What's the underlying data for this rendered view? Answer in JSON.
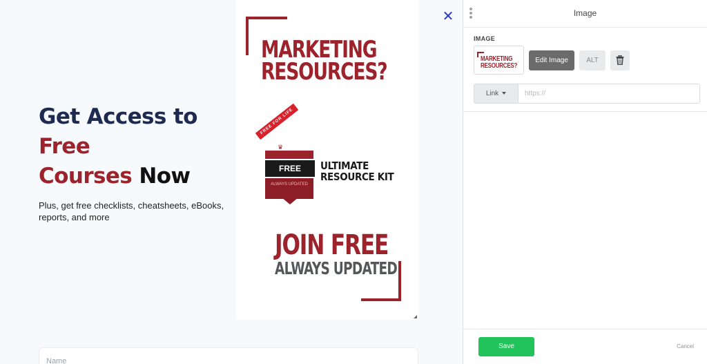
{
  "canvas": {
    "hero": {
      "line1": "Get Access to",
      "line2": "Free",
      "line3a": "Courses",
      "line3b": "Now",
      "subtitle": "Plus, get free checklists, cheatsheets, eBooks, reports, and more"
    },
    "promo": {
      "headline_1": "MARKETING",
      "headline_2": "RESOURCES?",
      "ribbon": "FREE FOR LIFE",
      "kit_badge": "FREE",
      "kit_badge_sub": "ALWAYS UPDATED",
      "kit_title_1": "ULTIMATE",
      "kit_title_2": "RESOURCE KIT",
      "join": "JOIN FREE",
      "always": "ALWAYS UPDATED"
    },
    "close_icon": "close-icon",
    "name_placeholder": "Name",
    "colors": {
      "navy": "#1e2a4f",
      "brand_red": "#9c232c",
      "close_blue": "#2a35c9"
    }
  },
  "panel": {
    "title": "Image",
    "section_label": "IMAGE",
    "thumb_text_1": "MARKETING",
    "thumb_text_2": "RESOURCES?",
    "edit_image_label": "Edit Image",
    "alt_label": "ALT",
    "delete_icon": "trash-icon",
    "link_label": "Link",
    "link_placeholder": "https://",
    "link_value": "",
    "save_label": "Save",
    "cancel_label": "Cancel",
    "colors": {
      "save_green": "#23c35b",
      "edit_gray": "#6b6b6b"
    }
  }
}
